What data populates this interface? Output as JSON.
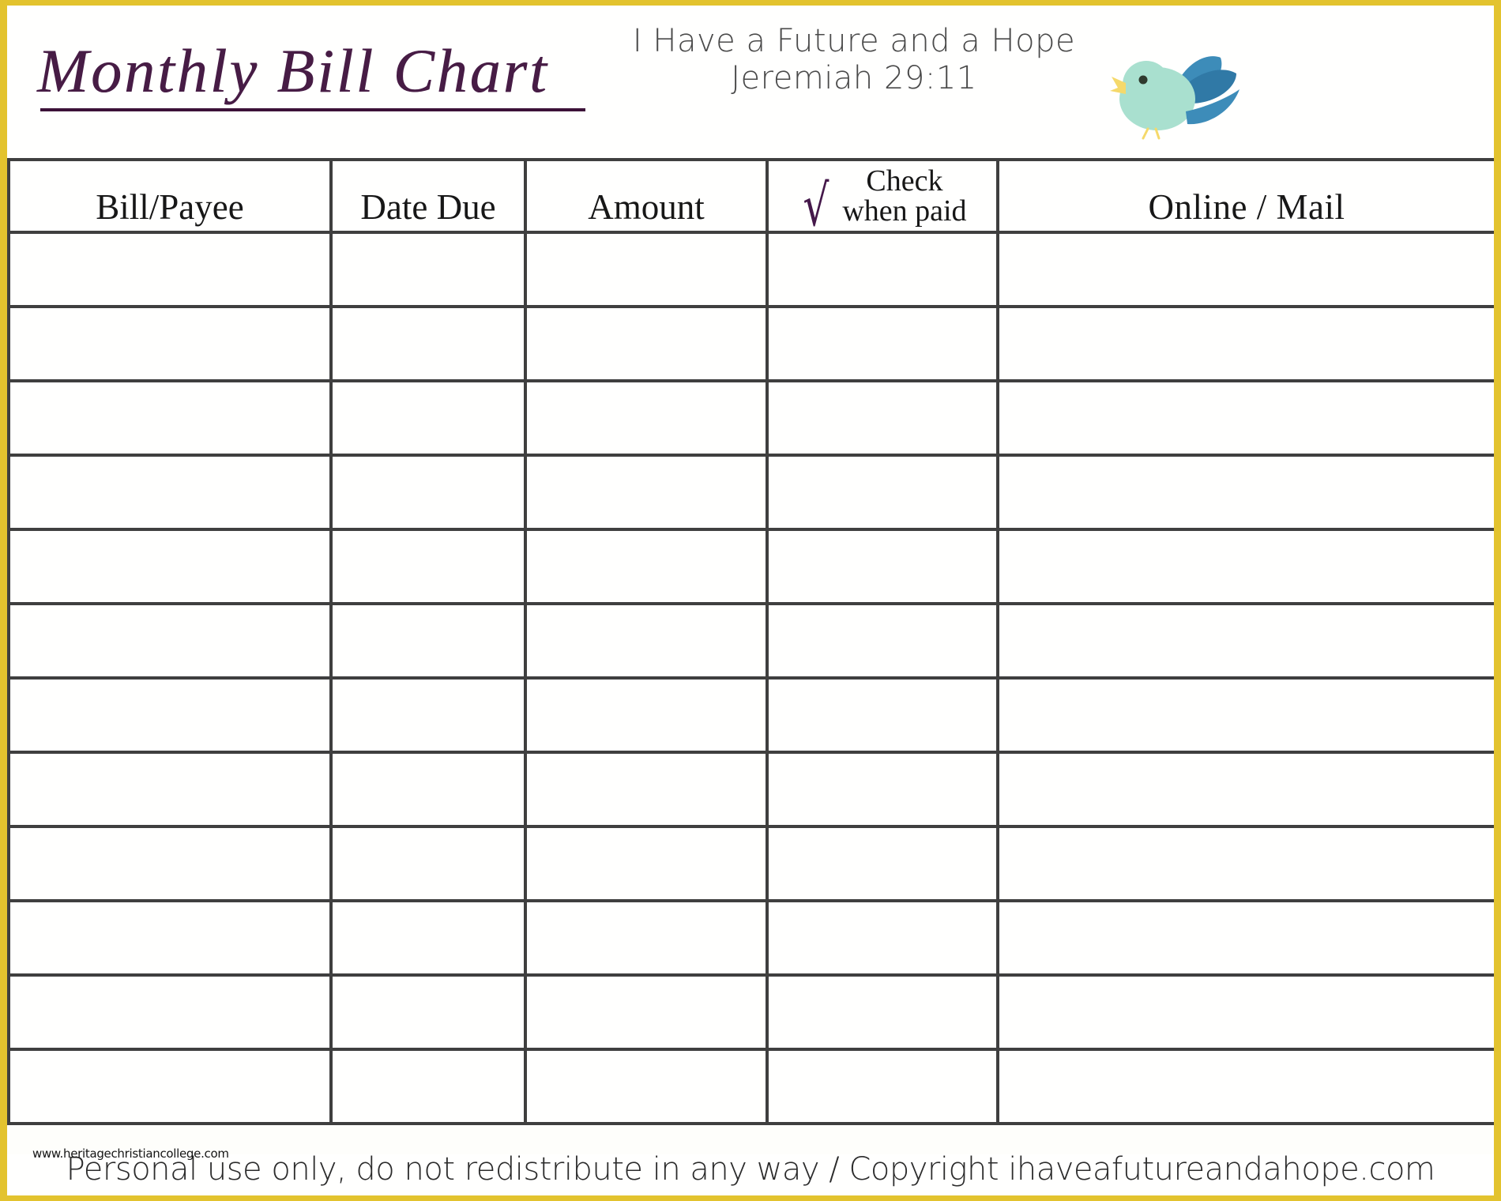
{
  "page": {
    "border_color": "#E3C32E",
    "background": "#FFFFFE"
  },
  "header": {
    "title": "Monthly Bill Chart",
    "title_color": "#471C45",
    "tagline_line1": "I Have a Future and a Hope",
    "tagline_line2": "Jeremiah 29:11",
    "bird_icon": "bird-icon",
    "bird_body_color": "#A9E0CF",
    "bird_wing_color": "#3D8CB9",
    "bird_beak_color": "#F5D96B"
  },
  "table": {
    "columns": [
      {
        "key": "bill",
        "label": "Bill/Payee"
      },
      {
        "key": "date",
        "label": "Date Due"
      },
      {
        "key": "amount",
        "label": "Amount"
      },
      {
        "key": "check",
        "label_line1": "Check",
        "label_line2": "when paid",
        "glyph": "checkmark-icon",
        "glyph_char": "√",
        "glyph_color": "#45184A"
      },
      {
        "key": "online",
        "label": "Online / Mail"
      }
    ],
    "row_count": 12,
    "rows": [
      {
        "bill": "",
        "date": "",
        "amount": "",
        "check": "",
        "online": ""
      },
      {
        "bill": "",
        "date": "",
        "amount": "",
        "check": "",
        "online": ""
      },
      {
        "bill": "",
        "date": "",
        "amount": "",
        "check": "",
        "online": ""
      },
      {
        "bill": "",
        "date": "",
        "amount": "",
        "check": "",
        "online": ""
      },
      {
        "bill": "",
        "date": "",
        "amount": "",
        "check": "",
        "online": ""
      },
      {
        "bill": "",
        "date": "",
        "amount": "",
        "check": "",
        "online": ""
      },
      {
        "bill": "",
        "date": "",
        "amount": "",
        "check": "",
        "online": ""
      },
      {
        "bill": "",
        "date": "",
        "amount": "",
        "check": "",
        "online": ""
      },
      {
        "bill": "",
        "date": "",
        "amount": "",
        "check": "",
        "online": ""
      },
      {
        "bill": "",
        "date": "",
        "amount": "",
        "check": "",
        "online": ""
      },
      {
        "bill": "",
        "date": "",
        "amount": "",
        "check": "",
        "online": ""
      },
      {
        "bill": "",
        "date": "",
        "amount": "",
        "check": "",
        "online": ""
      }
    ],
    "border_color": "#3F3F3F"
  },
  "footer": {
    "copyright": "Personal use only, do not redistribute in any way / Copyright ihaveafutureandahope.com",
    "watermark": "www.heritagechristiancollege.com"
  }
}
